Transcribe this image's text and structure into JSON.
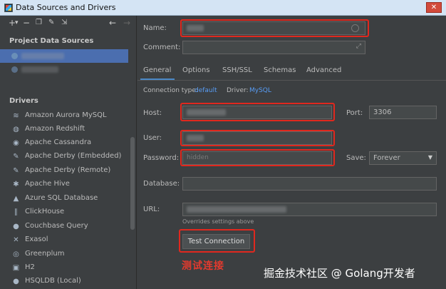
{
  "window": {
    "title": "Data Sources and Drivers",
    "close_label": "✕"
  },
  "toolbar": {
    "icons": [
      "add-icon",
      "remove-icon",
      "copy-icon",
      "wrench-icon",
      "import-icon",
      "back-icon",
      "forward-icon"
    ]
  },
  "left": {
    "project_header": "Project Data Sources",
    "drivers_header": "Drivers",
    "drivers": [
      {
        "label": "Amazon Aurora MySQL",
        "icon": "≋"
      },
      {
        "label": "Amazon Redshift",
        "icon": "◍"
      },
      {
        "label": "Apache Cassandra",
        "icon": "◉"
      },
      {
        "label": "Apache Derby (Embedded)",
        "icon": "✎"
      },
      {
        "label": "Apache Derby (Remote)",
        "icon": "✎"
      },
      {
        "label": "Apache Hive",
        "icon": "✱"
      },
      {
        "label": "Azure SQL Database",
        "icon": "▲"
      },
      {
        "label": "ClickHouse",
        "icon": "∥"
      },
      {
        "label": "Couchbase Query",
        "icon": "●"
      },
      {
        "label": "Exasol",
        "icon": "✕"
      },
      {
        "label": "Greenplum",
        "icon": "◎"
      },
      {
        "label": "H2",
        "icon": "▣"
      },
      {
        "label": "HSQLDB (Local)",
        "icon": "●"
      }
    ]
  },
  "form": {
    "name_label": "Name:",
    "comment_label": "Comment:",
    "tabs": [
      "General",
      "Options",
      "SSH/SSL",
      "Schemas",
      "Advanced"
    ],
    "connection_type_label": "Connection type:",
    "connection_type_value": "default",
    "driver_label": "Driver:",
    "driver_value": "MySQL",
    "host_label": "Host:",
    "port_label": "Port:",
    "port_value": "3306",
    "user_label": "User:",
    "password_label": "Password:",
    "password_placeholder": "hidden",
    "save_label": "Save:",
    "save_value": "Forever",
    "database_label": "Database:",
    "url_label": "URL:",
    "url_note": "Overrides settings above",
    "test_button": "Test Connection"
  },
  "annotations": {
    "caption": "测试连接",
    "watermark": "掘金技术社区 @ Golang开发者",
    "highlight_color": "#e0281e"
  }
}
